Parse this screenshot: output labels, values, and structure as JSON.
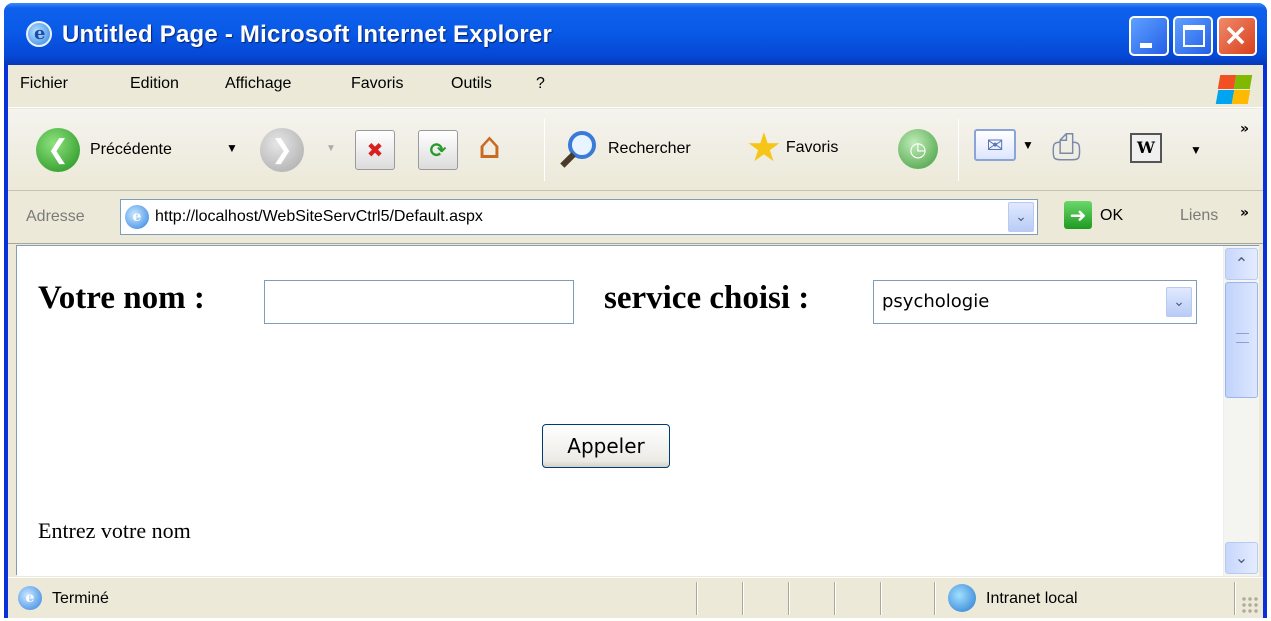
{
  "window": {
    "title": "Untitled Page - Microsoft Internet Explorer"
  },
  "menu": [
    "Fichier",
    "Edition",
    "Affichage",
    "Favoris",
    "Outils",
    "?"
  ],
  "toolbar": {
    "back_label": "Précédente",
    "search_label": "Rechercher",
    "favorites_label": "Favoris",
    "more_glyph": "»"
  },
  "address": {
    "label": "Adresse",
    "url": "http://localhost/WebSiteServCtrl5/Default.aspx",
    "go_label": "OK",
    "links_label": "Liens"
  },
  "form": {
    "name_label": "Votre nom :",
    "name_value": "",
    "service_label": "service choisi :",
    "service_value": "psychologie",
    "call_button": "Appeler",
    "message": "Entrez votre nom"
  },
  "status": {
    "text": "Terminé",
    "zone": "Intranet local"
  },
  "colors": {
    "titlebar": "#0a5ae8",
    "chrome": "#ece9d8",
    "close": "#d8401e"
  }
}
